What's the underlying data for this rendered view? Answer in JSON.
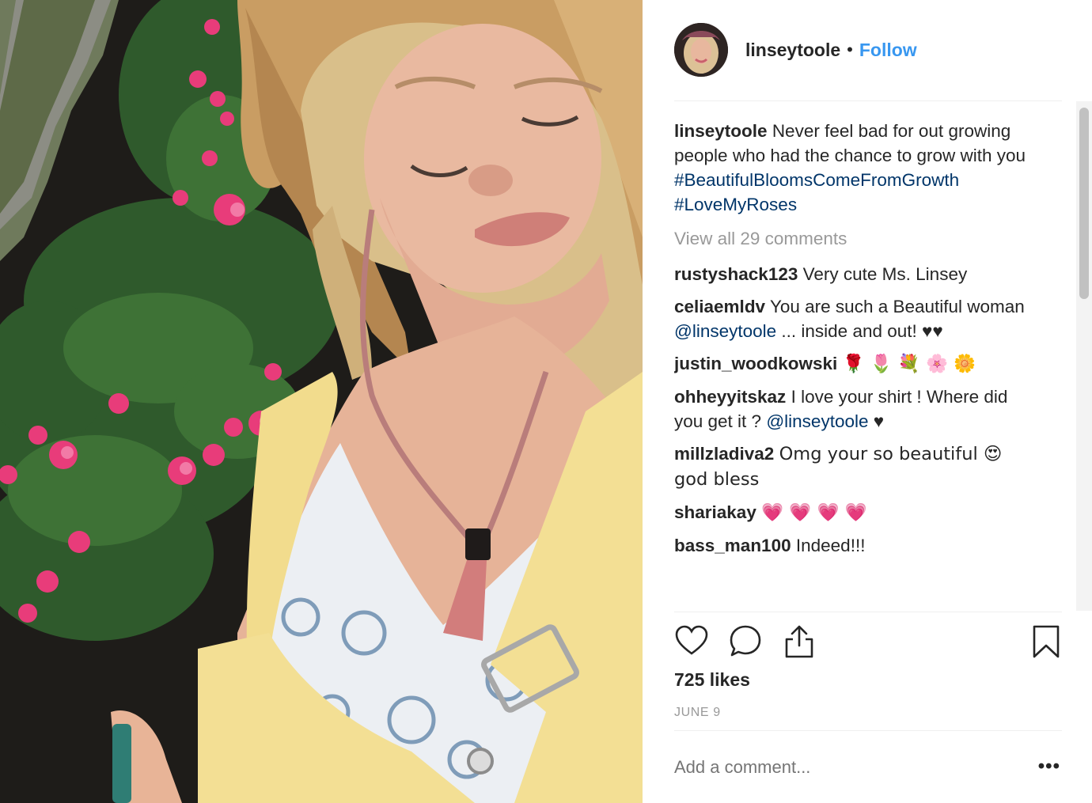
{
  "post": {
    "username": "linseytoole",
    "separator": "•",
    "follow_label": "Follow"
  },
  "caption": {
    "username": "linseytoole",
    "text": "Never feel bad for out growing people who had the chance to grow with you",
    "hashtag1": "#BeautifulBloomsComeFromGrowth",
    "hashtag2": "#LoveMyRoses"
  },
  "view_all_comments": "View all 29 comments",
  "comments": [
    {
      "username": "rustyshack123",
      "text": "Very cute Ms. Linsey"
    },
    {
      "username": "celiaemldv",
      "text_before": "You are such a Beautiful woman ",
      "mention": "@linseytoole",
      "text_after": " ... inside and out! ♥♥"
    },
    {
      "username": "justin_woodkowski",
      "text": "🌹 🌷 💐 🌸 🌼"
    },
    {
      "username": "ohheyyitskaz",
      "text_before": "I love your shirt ! Where did you get it ? ",
      "mention": "@linseytoole",
      "text_after": " ♥"
    },
    {
      "username": "millzladiva2",
      "text": "Omg your so beautiful 😍 god bless"
    },
    {
      "username": "shariakay",
      "text": "💗 💗 💗 💗"
    },
    {
      "username": "bass_man100",
      "text": "Indeed!!!"
    }
  ],
  "likes": "725 likes",
  "date": "JUNE 9",
  "add_comment_placeholder": "Add a comment...",
  "more_options": "•••",
  "icons": [
    "heart-icon",
    "comment-icon",
    "share-icon",
    "bookmark-icon"
  ],
  "colors": {
    "link": "#3897f0",
    "hashtag": "#003569",
    "muted": "#999999",
    "text": "#262626"
  }
}
